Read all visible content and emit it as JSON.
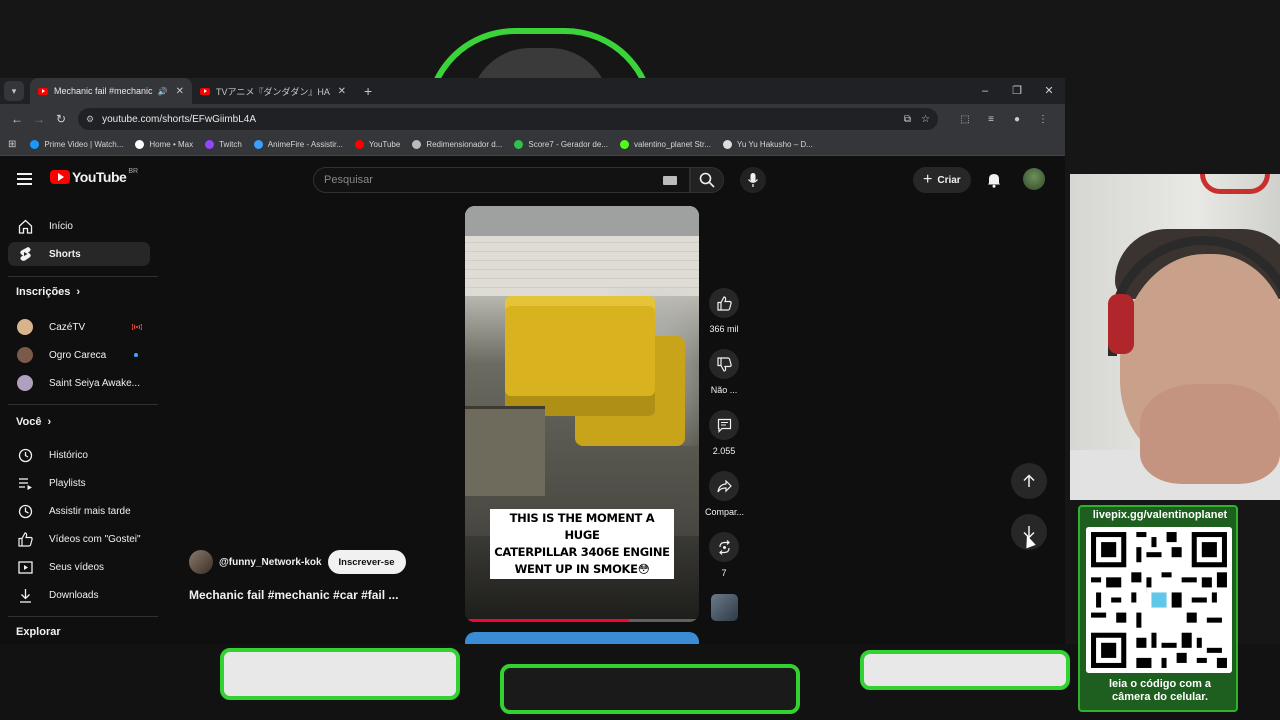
{
  "browser": {
    "tabs": [
      {
        "title": "Mechanic fail #mechanic #",
        "active": true
      },
      {
        "title": "TVアニメ『ダンダダン』HAYASii「Hun",
        "active": false
      }
    ],
    "url": "youtube.com/shorts/EFwGiimbL4A",
    "bookmarks": [
      {
        "label": "Prime Video | Watch...",
        "color": "#1a98ff"
      },
      {
        "label": "Home • Max",
        "color": "#ffffff"
      },
      {
        "label": "Twitch",
        "color": "#9146ff"
      },
      {
        "label": "AnimeFire - Assistir...",
        "color": "#3aa0ff"
      },
      {
        "label": "YouTube",
        "color": "#ff0000"
      },
      {
        "label": "Redimensionador d...",
        "color": "#bbbbbb"
      },
      {
        "label": "Score7 - Gerador de...",
        "color": "#2ec24a"
      },
      {
        "label": "valentino_planet Str...",
        "color": "#53fc18"
      },
      {
        "label": "Yu Yu Hakusho – D...",
        "color": "#dddddd"
      }
    ]
  },
  "youtube": {
    "logo_text": "YouTube",
    "region": "BR",
    "search_placeholder": "Pesquisar",
    "create_label": "Criar",
    "sidebar": {
      "main": [
        {
          "label": "Início",
          "icon": "home-icon"
        },
        {
          "label": "Shorts",
          "icon": "shorts-icon",
          "active": true
        }
      ],
      "subscriptions_title": "Inscrições",
      "subscriptions": [
        {
          "label": "CazéTV",
          "badge": "live",
          "color": "#d9b38c"
        },
        {
          "label": "Ogro Careca",
          "badge": "new",
          "color": "#7a5a4a"
        },
        {
          "label": "Saint Seiya Awake...",
          "badge": "",
          "color": "#b0a0c0"
        }
      ],
      "you_title": "Você",
      "you": [
        {
          "label": "Histórico",
          "icon": "history-icon"
        },
        {
          "label": "Playlists",
          "icon": "playlists-icon"
        },
        {
          "label": "Assistir mais tarde",
          "icon": "watch-later-icon"
        },
        {
          "label": "Vídeos com \"Gostei\"",
          "icon": "like-icon"
        },
        {
          "label": "Seus vídeos",
          "icon": "your-videos-icon"
        },
        {
          "label": "Downloads",
          "icon": "download-icon"
        }
      ],
      "explore_title": "Explorar"
    },
    "short": {
      "caption_lines": [
        "THIS IS THE MOMENT A HUGE",
        "CATERPILLAR 3406E ENGINE",
        "WENT UP IN SMOKE😳"
      ],
      "channel": "@funny_Network-kok",
      "subscribe_label": "Inscrever-se",
      "title": "Mechanic fail #mechanic #car #fail ...",
      "progress": 0.7,
      "likes": "366 mil",
      "dislike_label": "Não ...",
      "comments": "2.055",
      "share_label": "Compar...",
      "remix_count": "7"
    }
  },
  "overlay": {
    "qr_top": "livepix.gg/valentinoplanet",
    "qr_bottom_1": "leia o código com a",
    "qr_bottom_2": "câmera do celular."
  }
}
